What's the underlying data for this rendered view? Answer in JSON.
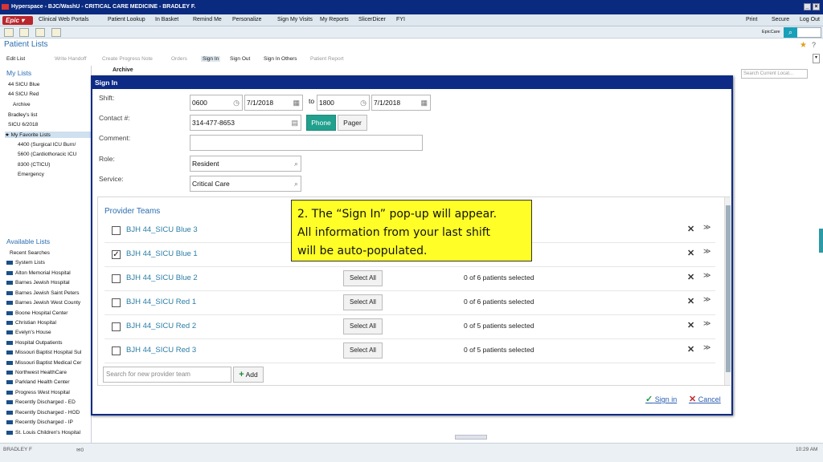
{
  "titlebar": {
    "title": "Hyperspace - BJC/WashU - CRITICAL CARE MEDICINE - BRADLEY F."
  },
  "toolbar": {
    "epic_label": "Epic",
    "items": [
      "Clinical Web Portals",
      "Patient Lookup",
      "In Basket",
      "Remind Me",
      "Personalize",
      "Sign My Visits",
      "My Reports",
      "SlicerDicer",
      "FYI"
    ],
    "right_items": [
      "Print",
      "Secure",
      "Log Out"
    ],
    "epiccare": "EpicCare"
  },
  "page": {
    "title": "Patient Lists",
    "actions": [
      "Edit List",
      "Write Handoff",
      "Create Progress Note",
      "Orders",
      "Sign In",
      "Sign Out",
      "Sign In Others",
      "Patient Report"
    ],
    "archive_label": "Archive",
    "search_placeholder": "Search Current Locat..."
  },
  "my_lists": {
    "header": "My Lists",
    "items": [
      "44 SICU Blue",
      "44 SICU Red",
      "Archive",
      "Bradley's list",
      "SICU 6/2018",
      "My Favorite Lists",
      "4400 (Surgical ICU Burn/",
      "5600 (Cardiothoracic ICU",
      "8300 (CTICU)",
      "Emergency"
    ]
  },
  "available_lists": {
    "header": "Available Lists",
    "items": [
      "Recent Searches",
      "System Lists",
      "Alton Memorial Hospital",
      "Barnes Jewish Hospital",
      "Barnes Jewish Saint Peters",
      "Barnes Jewish West County",
      "Boone Hospital Center",
      "Christian Hospital",
      "Evelyn's House",
      "Hospital Outpatients",
      "Missouri Baptist Hospital Sul",
      "Missouri Baptist Medical Cer",
      "Northwest HealthCare",
      "Parkland Health Center",
      "Progress West Hospital",
      "Recently Discharged - ED",
      "Recently Discharged - HOD",
      "Recently Discharged - IP",
      "St. Louis Children's Hospital"
    ]
  },
  "status": {
    "user": "BRADLEY F",
    "time": "10:29 AM"
  },
  "modal": {
    "title": "Sign In",
    "shift_label": "Shift:",
    "shift_start_time": "0600",
    "shift_start_date": "7/1/2018",
    "to_label": "to",
    "shift_end_time": "1800",
    "shift_end_date": "7/1/2018",
    "contact_label": "Contact #:",
    "contact_value": "314-477-8653",
    "phone_label": "Phone",
    "pager_label": "Pager",
    "comment_label": "Comment:",
    "comment_value": "",
    "role_label": "Role:",
    "role_value": "Resident",
    "service_label": "Service:",
    "service_value": "Critical Care",
    "teams_title": "Provider Teams",
    "teams": [
      {
        "name": "BJH 44_SICU Blue 3",
        "checked": false,
        "select_all": "",
        "count": ""
      },
      {
        "name": "BJH 44_SICU Blue 1",
        "checked": true,
        "select_all": "",
        "count": ""
      },
      {
        "name": "BJH 44_SICU Blue 2",
        "checked": false,
        "select_all": "Select All",
        "count": "0 of 6 patients selected"
      },
      {
        "name": "BJH 44_SICU Red 1",
        "checked": false,
        "select_all": "Select All",
        "count": "0 of 6 patients selected"
      },
      {
        "name": "BJH 44_SICU Red 2",
        "checked": false,
        "select_all": "Select All",
        "count": "0 of 5 patients selected"
      },
      {
        "name": "BJH 44_SICU Red 3",
        "checked": false,
        "select_all": "Select All",
        "count": "0 of 5 patients selected"
      }
    ],
    "team_search_placeholder": "Search for new provider team",
    "add_label": "Add",
    "signin_label": "Sign in",
    "cancel_label": "Cancel"
  },
  "callout": {
    "line1": "2. The “Sign In” pop-up will appear.",
    "line2": "All information from your last shift",
    "line3": "will be auto-populated."
  },
  "colors": {
    "titlebar": "#0a2a80",
    "accent_teal": "#21a08e",
    "callout": "#ffff27",
    "link": "#2a6db0"
  }
}
